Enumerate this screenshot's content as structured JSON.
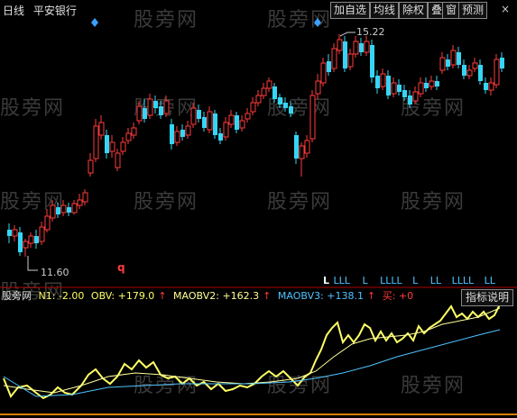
{
  "window": {
    "mode": "日线",
    "stock": "平安银行"
  },
  "toolbar": {
    "add": "加自选",
    "ma": "均线",
    "rights": "除权",
    "overlay": "叠",
    "window": "窗",
    "forecast": "预测"
  },
  "watermark": "股旁网",
  "price": {
    "high": "15.22",
    "low": "11.60"
  },
  "markers": {
    "q": "q",
    "signals": [
      "L",
      "L",
      "L",
      "L",
      "L",
      "L",
      "L",
      "L",
      "L",
      "L",
      "L",
      "L",
      "L",
      "L",
      "L",
      "L",
      "L",
      "L"
    ]
  },
  "indicator": {
    "name": "股旁网",
    "n1": "N1: -2.00",
    "obv": "OBV: +179.0",
    "maobv2": "MAOBV2: +162.3",
    "maobv3": "MAOBV3: +138.1",
    "buy": "买: +0",
    "help": "指标说明"
  },
  "colors": {
    "up": "#ff3b3b",
    "down": "#35d6f5",
    "obv": "#ffff66",
    "ma2": "#ffff99",
    "ma3": "#4fc3ff",
    "diamond": "#3aa0ff"
  }
}
